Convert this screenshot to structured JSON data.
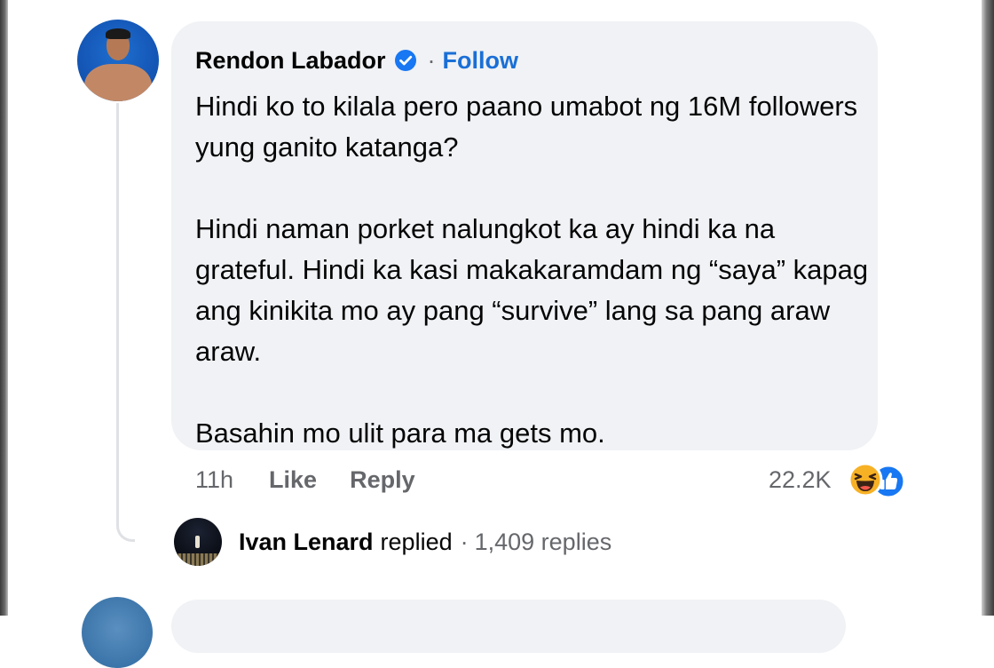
{
  "comment": {
    "author": "Rendon Labador",
    "separator": "·",
    "follow_label": "Follow",
    "paragraphs": [
      "Hindi ko to kilala pero paano umabot ng 16M followers yung ganito katanga?",
      "Hindi naman porket nalungkot ka ay hindi ka na grateful. Hindi ka kasi makakaramdam ng “saya” kapag ang kinikita mo ay pang “survive” lang sa pang araw araw.",
      "Basahin mo ulit para ma gets mo."
    ],
    "time": "11h",
    "like_label": "Like",
    "reply_label": "Reply",
    "reaction_count": "22.2K",
    "reaction_icons": [
      "haha-icon",
      "like-icon"
    ]
  },
  "reply_summary": {
    "name": "Ivan Lenard",
    "verb": "replied",
    "separator": "·",
    "count": "1,409 replies"
  },
  "colors": {
    "bubble_bg": "#f0f2f5",
    "link_blue": "#1a6fd6",
    "secondary_text": "#65676b",
    "verified_blue": "#1877f2"
  }
}
